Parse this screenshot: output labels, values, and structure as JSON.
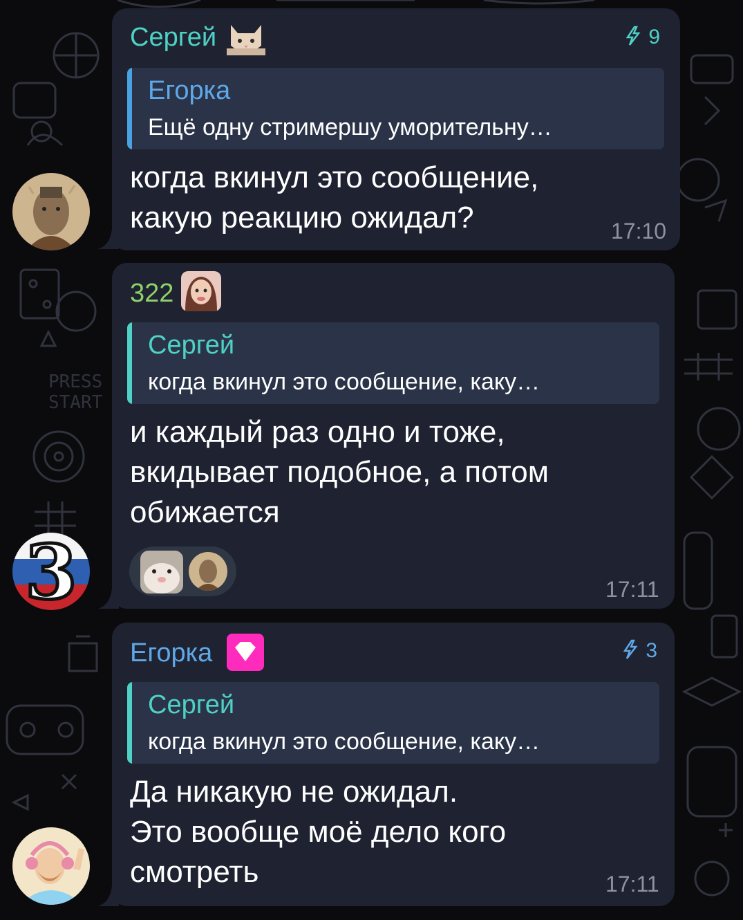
{
  "messages": [
    {
      "sender": "Сергей",
      "sender_color": "#4fd1c5",
      "boost_count": "9",
      "boost_icon": "lightning-icon",
      "reply": {
        "name": "Егорка",
        "text": "Ещё одну стримершу уморительну…"
      },
      "text": "когда вкинул это сообщение,\nкакую реакцию ожидал?",
      "time": "17:10"
    },
    {
      "sender": "322",
      "sender_color": "#8fd26a",
      "reply": {
        "name": "Сергей",
        "text": "когда вкинул это сообщение, каку…"
      },
      "text": "и каждый раз одно и тоже,\nвкидывает подобное, а потом\nобижается",
      "reactions": [
        "hamster-reaction",
        "robot-avatar-reaction"
      ],
      "time": "17:11"
    },
    {
      "sender": "Егорка",
      "sender_color": "#5fa8e8",
      "boost_count": "3",
      "boost_icon": "lightning-icon",
      "reply": {
        "name": "Сергей",
        "text": "когда вкинул это сообщение, каку…"
      },
      "text": "Да никакую не ожидал.\nЭто вообще моё дело кого\nсмотреть",
      "time": "17:11"
    }
  ],
  "avatars": {
    "first": "cyborg-avatar",
    "second": "number-three-badge-avatar",
    "second_label": "3",
    "third": "bearded-man-headphones-avatar"
  },
  "colors": {
    "bubble": "#1f2230",
    "reply_bg": "#2a3347",
    "reply_accent": "#4fd1c5",
    "time": "#8c93a3",
    "background": "#0b0b0e"
  }
}
